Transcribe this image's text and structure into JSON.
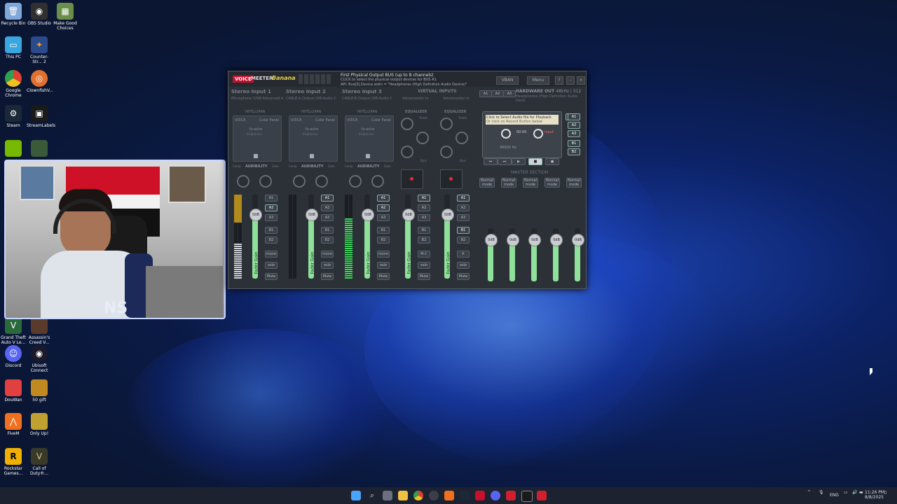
{
  "desktop_icons": [
    {
      "label": "Recycle Bin",
      "icon": "recycle-bin-icon",
      "color": "#7fa7d8"
    },
    {
      "label": "OBS Studio",
      "icon": "obs-icon",
      "color": "#303030"
    },
    {
      "label": "Make Good Choices",
      "icon": "folder-icon",
      "color": "#6a8f4a"
    },
    {
      "label": "This PC",
      "icon": "monitor-icon",
      "color": "#3aa6e0"
    },
    {
      "label": "Counter-Str... 2",
      "icon": "cs2-icon",
      "color": "#2a4a8a"
    },
    {
      "label": "Google Chrome",
      "icon": "chrome-icon",
      "color": "#e0b020"
    },
    {
      "label": "ClownfishV...",
      "icon": "clownfish-icon",
      "color": "#e07030"
    },
    {
      "label": "Steam",
      "icon": "steam-icon",
      "color": "#1b2838"
    },
    {
      "label": "StreamLabels",
      "icon": "streamlabels-icon",
      "color": "#1a1a1a"
    },
    {
      "label": "Grand Theft Auto V Le...",
      "icon": "gta-icon",
      "color": "#2a6a3a"
    },
    {
      "label": "Assassin's Creed V...",
      "icon": "ac-icon",
      "color": "#5a3a2a"
    },
    {
      "label": "Discord",
      "icon": "discord-icon",
      "color": "#5865f2"
    },
    {
      "label": "Ubisoft Connect",
      "icon": "ubisoft-icon",
      "color": "#1a1a2a"
    },
    {
      "label": "DouWan",
      "icon": "douwan-icon",
      "color": "#e04040"
    },
    {
      "label": "50 gift",
      "icon": "gift-icon",
      "color": "#c08a20"
    },
    {
      "label": "FiveM",
      "icon": "fivem-icon",
      "color": "#f07020"
    },
    {
      "label": "Only Up!",
      "icon": "onlyup-icon",
      "color": "#c0a030"
    },
    {
      "label": "Rockstar Games...",
      "icon": "rockstar-icon",
      "color": "#f0b000"
    },
    {
      "label": "Call of Duty®...",
      "icon": "cod-icon",
      "color": "#3a3a2a"
    }
  ],
  "vm": {
    "logo_voice": "VOICE",
    "logo_meter": "MEETER",
    "logo_banana": "Banana",
    "info_title": "First Physical Output BUS (up to 8 channels)",
    "info_line1": "CLICK to select the physical output devices for BUS A1",
    "info_line2": "API: Bus[0].Device.wdm = \"Headphones (High Definition Audio Device)\"",
    "vban": "VBAN",
    "menu": "Menu",
    "strips": [
      {
        "title": "Stereo Input 1",
        "sub": "Microphone (USB Advanced A"
      },
      {
        "title": "Stereo Input 2",
        "sub": "CABLE-A Output (VB-Audio C"
      },
      {
        "title": "Stereo Input 3",
        "sub": "CABLE-B Output (VB-Audio C"
      }
    ],
    "virtual_inputs": "VIRTUAL INPUTS",
    "voicemeeter_in": "Voicemeeter In",
    "equalizer": "EQUALIZER",
    "intellipan": "INTELLIPAN",
    "voice": "VOICE",
    "color_panel": "Color Panel",
    "fx_echo": "fx echo",
    "brightness": "Brightness",
    "comp": "Comp.",
    "audibility": "AUDIBILITY",
    "gate": "Gate",
    "treble": "Treble",
    "bass": "Bass",
    "hw_out_label": "HARDWARE OUT",
    "hw_out_rate": "48kHz | 512",
    "hw_out_device": "Headphones (High Definition Audio Devic",
    "cassette_line1": "Click to Select Audio file for Playback",
    "cassette_line2": "Or click on Record Button below",
    "cassette_time": "00:00",
    "cassette_rate": "48000 Hz",
    "cassette_input": "input",
    "master_section": "MASTER SECTION",
    "normal_mode": "Normal mode",
    "fader_label": "Fader Gain",
    "db": "0dB",
    "bus": [
      "A1",
      "A2",
      "A3",
      "B1",
      "B2"
    ],
    "mono": "mono",
    "solo": "solo",
    "mute": "Mute",
    "mc": "M.C",
    "k": "K",
    "hw_bus": [
      "A1",
      "A2",
      "A3"
    ],
    "cassette_bus": [
      "A1",
      "A2",
      "A3",
      "B1",
      "B2"
    ]
  },
  "taskbar": {
    "lang": "ENG",
    "time": "11:26 PM",
    "date": "8/8/2025",
    "show_hidden": "^"
  },
  "webcam_logo": "NS"
}
